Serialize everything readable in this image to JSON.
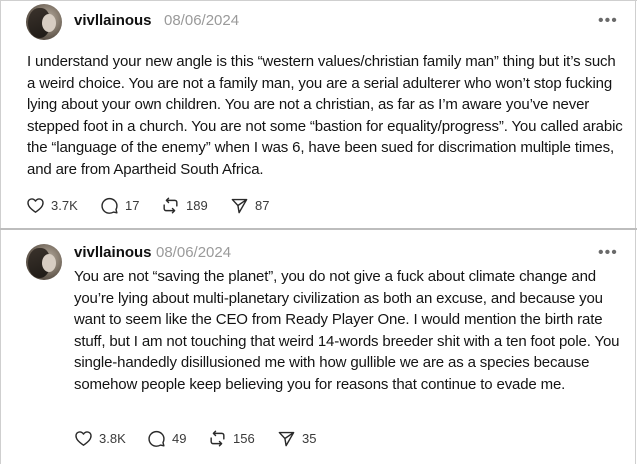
{
  "posts": [
    {
      "username": "vivllainous",
      "date": "08/06/2024",
      "more_icon": "more-horizontal-icon",
      "body": "I understand your new angle is this “western values/christian family man” thing but it’s such a weird choice. You are not a family man, you are a serial adulterer who won’t stop fucking lying about your own children. You are not a christian, as far as I’m aware you’ve never stepped foot in a church. You are not some “bastion for equality/progress”. You called arabic the “language of the enemy” when I was 6, have been sued for discrimation multiple times, and are from Apartheid South Africa.",
      "likes": "3.7K",
      "replies": "17",
      "reposts": "189",
      "shares": "87"
    },
    {
      "username": "vivllainous",
      "date": "08/06/2024",
      "more_icon": "more-horizontal-icon",
      "body": "You are not “saving the planet”, you do not give a fuck about climate change and you’re lying about multi-planetary civilization as both an excuse, and because you want to seem like the CEO from Ready Player One. I would mention the birth rate stuff, but I am not touching that weird 14-words breeder shit with a ten foot pole. You single-handedly disillusioned me with how gullible we are as a species because somehow people keep believing you for reasons that continue to evade me.",
      "likes": "3.8K",
      "replies": "49",
      "reposts": "156",
      "shares": "35"
    }
  ],
  "icons": {
    "like": "heart-icon",
    "reply": "comment-icon",
    "repost": "repost-icon",
    "share": "send-icon"
  },
  "colors": {
    "text": "#101010",
    "muted": "#9a9a9a",
    "border": "#cfcfcf"
  }
}
